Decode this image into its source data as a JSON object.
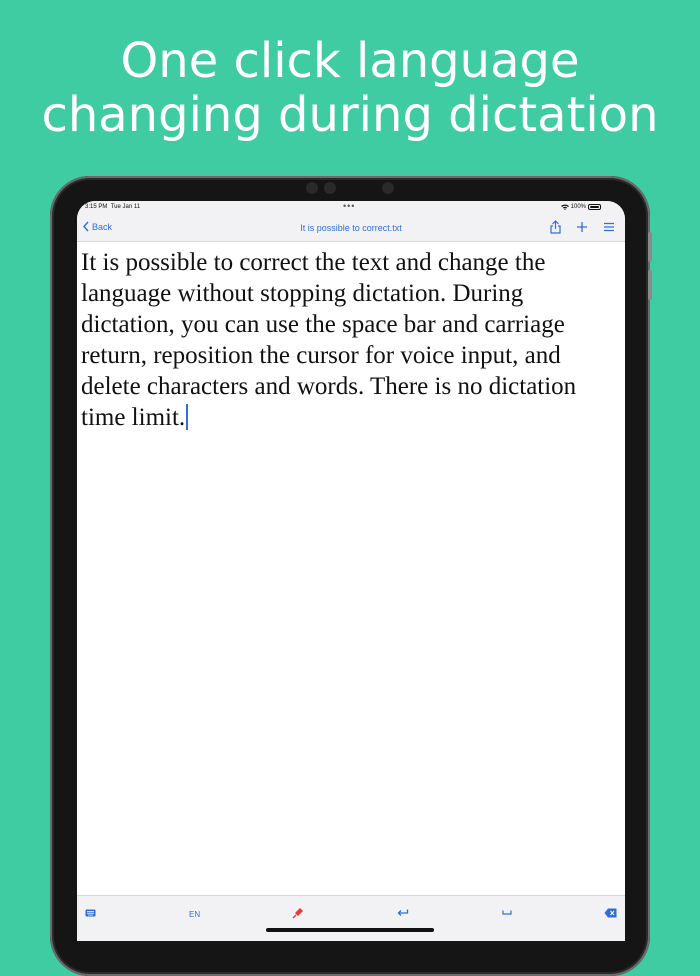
{
  "headline": {
    "line1": "One click language",
    "line2": "changing during dictation"
  },
  "status_bar": {
    "time": "3:15 PM",
    "date": "Tue Jan 11",
    "battery": "100%",
    "dots": "•••"
  },
  "nav": {
    "back_label": "Back",
    "title": "It is possible to correct.txt",
    "icons": [
      "share-icon",
      "plus-icon",
      "menu-icon"
    ]
  },
  "document": {
    "lines": [
      "It is possible to correct the text and change the",
      "language without stopping dictation. During",
      "dictation, you can use the space bar and carriage",
      "return, reposition the cursor for voice input, and",
      "delete characters and words. There is no dictation",
      "time limit."
    ]
  },
  "toolbar": {
    "language": "EN",
    "icons": [
      "keyboard-icon",
      "microphone-icon",
      "return-icon",
      "space-icon",
      "delete-icon"
    ]
  },
  "colors": {
    "background": "#40cca2",
    "accent": "#2f6fd6",
    "mic": "#e23a3a"
  }
}
